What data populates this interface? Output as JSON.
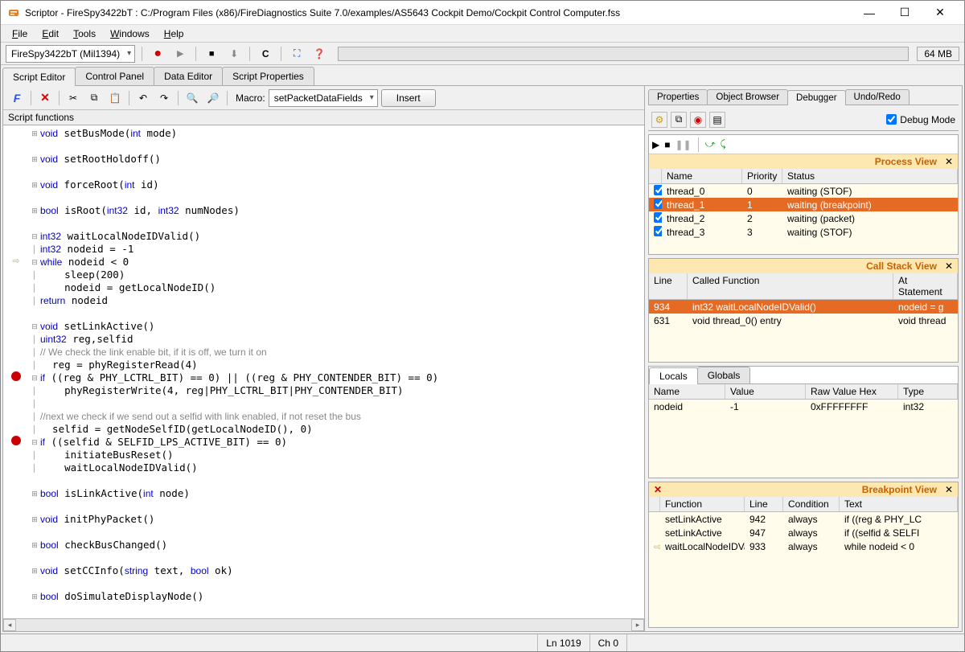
{
  "window": {
    "title": "Scriptor - FireSpy3422bT : C:/Program Files (x86)/FireDiagnostics Suite 7.0/examples/AS5643 Cockpit Demo/Cockpit Control Computer.fss"
  },
  "menu": {
    "file": "File",
    "edit": "Edit",
    "tools": "Tools",
    "windows": "Windows",
    "help": "Help"
  },
  "toolbar": {
    "device_combo": "FireSpy3422bT (Mil1394)",
    "memory": "64 MB"
  },
  "tabs": {
    "script_editor": "Script Editor",
    "control_panel": "Control Panel",
    "data_editor": "Data Editor",
    "script_properties": "Script Properties"
  },
  "editor_tb": {
    "macro_label": "Macro:",
    "macro_value": "setPacketDataFields",
    "insert": "Insert"
  },
  "script_functions_label": "Script functions",
  "right_tabs": {
    "properties": "Properties",
    "object_browser": "Object Browser",
    "debugger": "Debugger",
    "undo_redo": "Undo/Redo"
  },
  "debug_mode_label": "Debug Mode",
  "process_view": {
    "title": "Process View",
    "cols": {
      "name": "Name",
      "priority": "Priority",
      "status": "Status"
    },
    "rows": [
      {
        "name": "thread_0",
        "priority": "0",
        "status": "waiting (STOF)",
        "sel": false
      },
      {
        "name": "thread_1",
        "priority": "1",
        "status": "waiting (breakpoint)",
        "sel": true
      },
      {
        "name": "thread_2",
        "priority": "2",
        "status": "waiting (packet)",
        "sel": false
      },
      {
        "name": "thread_3",
        "priority": "3",
        "status": "waiting (STOF)",
        "sel": false
      }
    ]
  },
  "callstack": {
    "title": "Call Stack View",
    "cols": {
      "line": "Line",
      "fn": "Called Function",
      "at": "At Statement"
    },
    "rows": [
      {
        "line": "934",
        "fn": "int32 waitLocalNodeIDValid()",
        "at": "nodeid = g",
        "sel": true
      },
      {
        "line": "631",
        "fn": "void thread_0() entry",
        "at": "void thread",
        "sel": false
      }
    ]
  },
  "vars": {
    "tab_locals": "Locals",
    "tab_globals": "Globals",
    "cols": {
      "name": "Name",
      "value": "Value",
      "raw": "Raw Value Hex",
      "type": "Type"
    },
    "rows": [
      {
        "name": "nodeid",
        "value": "-1",
        "raw": "0xFFFFFFFF",
        "type": "int32"
      }
    ]
  },
  "breakpoints": {
    "title": "Breakpoint View",
    "cols": {
      "fn": "Function",
      "line": "Line",
      "cond": "Condition",
      "text": "Text"
    },
    "rows": [
      {
        "mark": "",
        "fn": "setLinkActive",
        "line": "942",
        "cond": "always",
        "text": "if ((reg & PHY_LC"
      },
      {
        "mark": "",
        "fn": "setLinkActive",
        "line": "947",
        "cond": "always",
        "text": "if ((selfid & SELFI"
      },
      {
        "mark": "⇨",
        "fn": "waitLocalNodeIDVali",
        "line": "933",
        "cond": "always",
        "text": "while nodeid < 0"
      }
    ]
  },
  "status": {
    "line": "Ln 1019",
    "col": "Ch 0"
  }
}
